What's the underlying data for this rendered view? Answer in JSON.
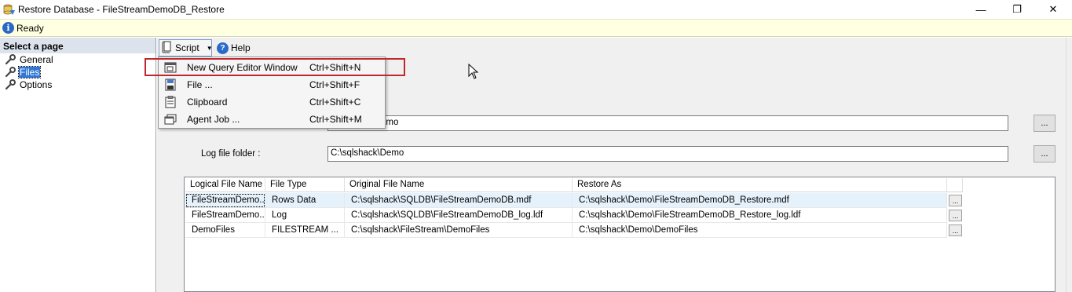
{
  "window": {
    "title": "Restore Database - FileStreamDemoDB_Restore",
    "minimize_glyph": "—",
    "maximize_glyph": "❐",
    "close_glyph": "✕"
  },
  "status": {
    "text": "Ready",
    "icon": "info-icon"
  },
  "left_pane": {
    "header": "Select a page",
    "items": [
      {
        "label": "General",
        "icon": "wrench-icon",
        "selected": false
      },
      {
        "label": "Files",
        "icon": "wrench-icon",
        "selected": true
      },
      {
        "label": "Options",
        "icon": "wrench-icon",
        "selected": false
      }
    ]
  },
  "toolbar": {
    "script_label": "Script",
    "help_label": "Help"
  },
  "script_menu": {
    "items": [
      {
        "label": "New Query Editor Window",
        "shortcut": "Ctrl+Shift+N",
        "icon": "query-window-icon",
        "highlighted": true
      },
      {
        "label": "File ...",
        "shortcut": "Ctrl+Shift+F",
        "icon": "save-file-icon"
      },
      {
        "label": "Clipboard",
        "shortcut": "Ctrl+Shift+C",
        "icon": "clipboard-icon"
      },
      {
        "label": "Agent Job ...",
        "shortcut": "Ctrl+Shift+M",
        "icon": "agent-job-icon"
      }
    ]
  },
  "form": {
    "data_folder_value_visible": "emo",
    "log_folder_label": "Log file folder :",
    "log_folder_value": "C:\\sqlshack\\Demo",
    "browse_label": "..."
  },
  "grid": {
    "columns": [
      "Logical File Name",
      "File Type",
      "Original File Name",
      "Restore As"
    ],
    "rows": [
      [
        "FileStreamDemo...",
        "Rows Data",
        "C:\\sqlshack\\SQLDB\\FileStreamDemoDB.mdf",
        "C:\\sqlshack\\Demo\\FileStreamDemoDB_Restore.mdf"
      ],
      [
        "FileStreamDemo...",
        "Log",
        "C:\\sqlshack\\SQLDB\\FileStreamDemoDB_log.ldf",
        "C:\\sqlshack\\Demo\\FileStreamDemoDB_Restore_log.ldf"
      ],
      [
        "DemoFiles",
        "FILESTREAM ...",
        "C:\\sqlshack\\FileStream\\DemoFiles",
        "C:\\sqlshack\\Demo\\DemoFiles"
      ]
    ],
    "row_button_label": "...",
    "selected_row": 0
  },
  "colors": {
    "status_bg": "#ffffe1",
    "highlight_box": "#c0282e",
    "selected_item": "#3178d5"
  }
}
